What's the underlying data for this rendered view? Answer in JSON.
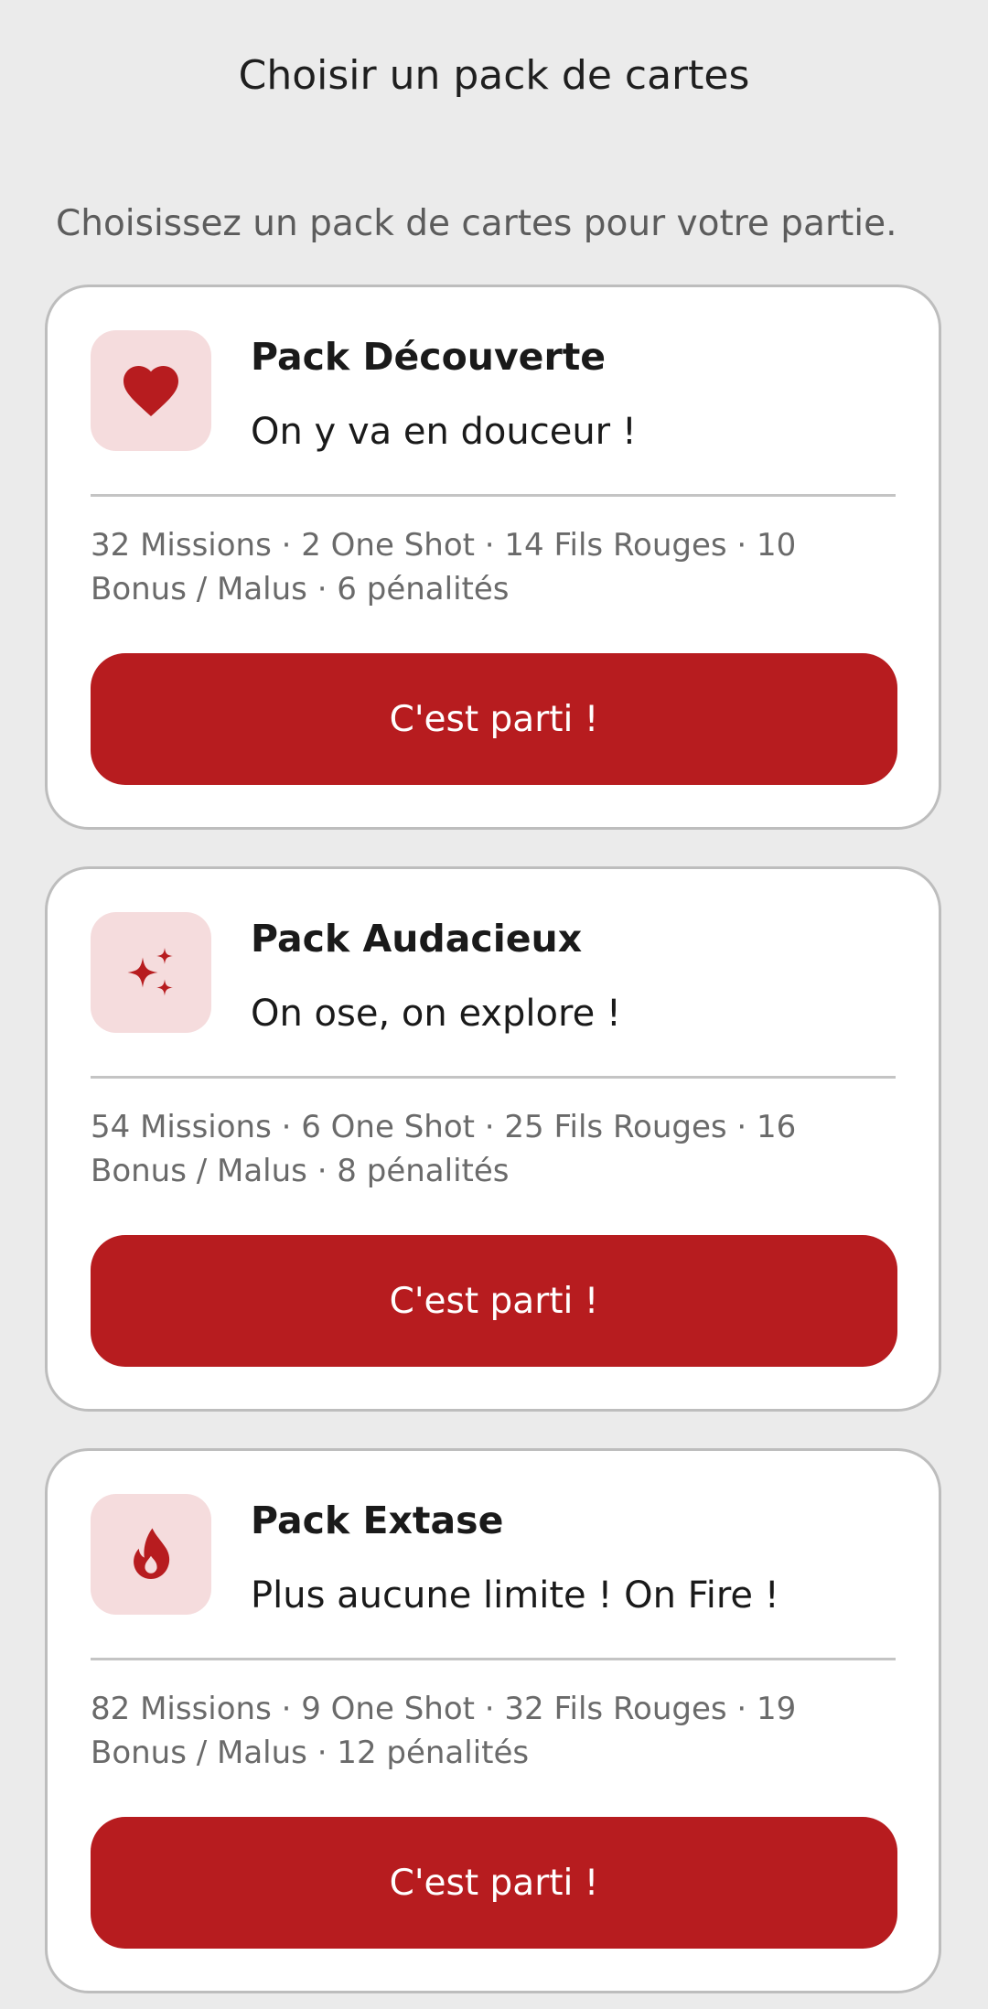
{
  "header": {
    "title": "Choisir un pack de cartes"
  },
  "intro": "Choisissez un pack de cartes pour votre partie.",
  "accent_color": "#b71c1f",
  "icon_background_color": "#f5dcdd",
  "packs": [
    {
      "name": "Pack Découverte",
      "tagline": "On y va en douceur !",
      "contents": "32 Missions · 2 One Shot · 14 Fils Rouges · 10 Bonus / Malus · 6 pénalités",
      "button_label": "C'est parti !",
      "icon": "heart-icon"
    },
    {
      "name": "Pack Audacieux",
      "tagline": "On ose, on explore !",
      "contents": "54 Missions · 6 One Shot · 25 Fils Rouges · 16 Bonus / Malus · 8 pénalités",
      "button_label": "C'est parti !",
      "icon": "sparkles-icon"
    },
    {
      "name": "Pack Extase",
      "tagline": "Plus aucune limite ! On Fire !",
      "contents": "82 Missions · 9 One Shot · 32 Fils Rouges · 19 Bonus / Malus · 12 pénalités",
      "button_label": "C'est parti !",
      "icon": "fire-icon"
    }
  ]
}
